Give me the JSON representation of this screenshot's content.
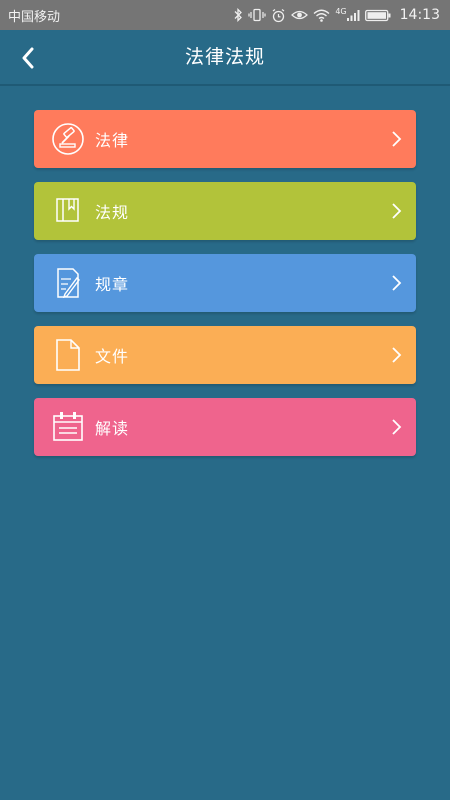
{
  "status_bar": {
    "carrier": "中国移动",
    "network": "4G",
    "time": "14:13"
  },
  "header": {
    "title": "法律法规",
    "back_icon": "chevron-left-icon"
  },
  "menu": {
    "items": [
      {
        "label": "法律",
        "icon": "gavel-icon",
        "color": "#ff7b5c"
      },
      {
        "label": "法规",
        "icon": "book-icon",
        "color": "#b2c33a"
      },
      {
        "label": "规章",
        "icon": "document-pen-icon",
        "color": "#5597dd"
      },
      {
        "label": "文件",
        "icon": "file-icon",
        "color": "#fbae55"
      },
      {
        "label": "解读",
        "icon": "calendar-board-icon",
        "color": "#ef648d"
      }
    ]
  },
  "colors": {
    "background": "#286a88",
    "status_bar": "#757575"
  }
}
